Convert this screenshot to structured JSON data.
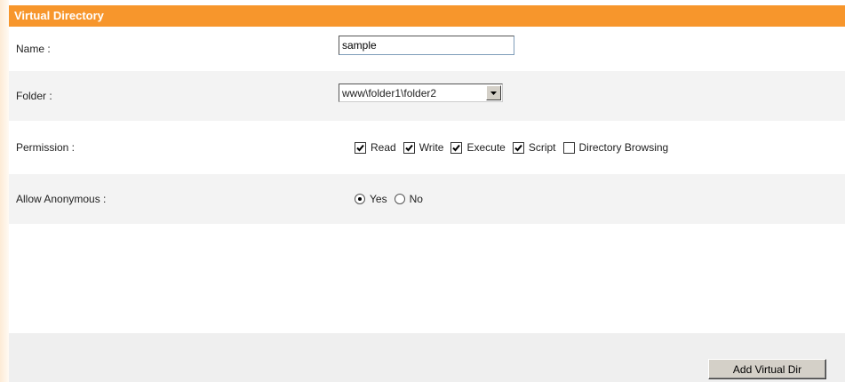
{
  "panel": {
    "title": "Virtual Directory"
  },
  "name_row": {
    "label": "Name :",
    "value": "sample"
  },
  "folder_row": {
    "label": "Folder :",
    "selected": "www\\folder1\\folder2"
  },
  "permission_row": {
    "label": "Permission :",
    "options": [
      {
        "label": "Read",
        "checked": true
      },
      {
        "label": "Write",
        "checked": true
      },
      {
        "label": "Execute",
        "checked": true
      },
      {
        "label": "Script",
        "checked": true
      },
      {
        "label": "Directory Browsing",
        "checked": false
      }
    ]
  },
  "anonymous_row": {
    "label": "Allow Anonymous :",
    "options": [
      {
        "label": "Yes",
        "selected": true
      },
      {
        "label": "No",
        "selected": false
      }
    ]
  },
  "actions": {
    "add_label": "Add Virtual Dir"
  },
  "colors": {
    "accent": "#f7962c",
    "row_alt": "#f3f3f3"
  }
}
